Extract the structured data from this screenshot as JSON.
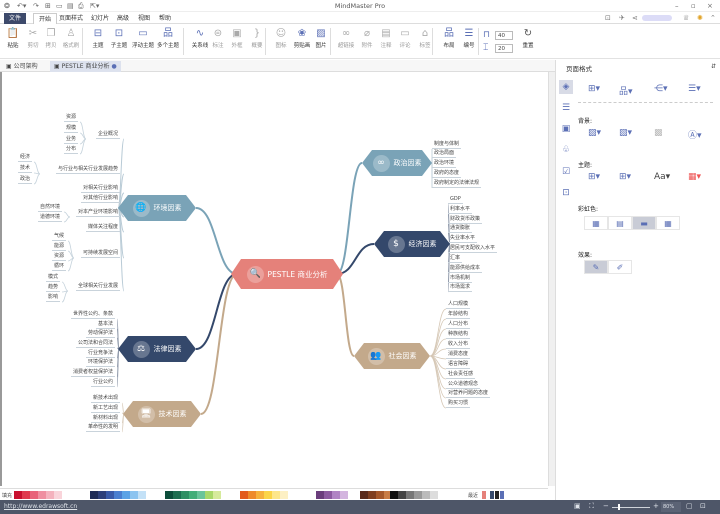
{
  "window": {
    "title": "MindMaster Pro"
  },
  "menu_tabs": [
    "文件",
    "开始",
    "页面样式",
    "幻灯片",
    "高级",
    "视图",
    "帮助"
  ],
  "ribbon": {
    "groups": [
      [
        {
          "label": "粘贴",
          "icon": "clipboard-icon"
        },
        {
          "label": "剪切",
          "icon": "scissors-icon",
          "disabled": true
        },
        {
          "label": "拷贝",
          "icon": "copy-icon",
          "disabled": true
        },
        {
          "label": "格式刷",
          "icon": "format-painter-icon",
          "disabled": true
        }
      ],
      [
        {
          "label": "主题",
          "icon": "topic-icon"
        },
        {
          "label": "子主题",
          "icon": "subtopic-icon"
        },
        {
          "label": "浮动主题",
          "icon": "floating-topic-icon"
        },
        {
          "label": "多个主题",
          "icon": "multiple-topics-icon"
        }
      ],
      [
        {
          "label": "关系线",
          "icon": "relationship-icon"
        },
        {
          "label": "标注",
          "icon": "callout-icon",
          "disabled": true
        },
        {
          "label": "外框",
          "icon": "boundary-icon",
          "disabled": true
        },
        {
          "label": "概要",
          "icon": "summary-icon",
          "disabled": true
        }
      ],
      [
        {
          "label": "图标",
          "icon": "mark-icon",
          "disabled": true
        },
        {
          "label": "剪贴画",
          "icon": "clipart-icon"
        },
        {
          "label": "图片",
          "icon": "picture-icon"
        }
      ],
      [
        {
          "label": "超链接",
          "icon": "hyperlink-icon",
          "disabled": true
        },
        {
          "label": "附件",
          "icon": "attachment-icon",
          "disabled": true
        },
        {
          "label": "注释",
          "icon": "note-icon",
          "disabled": true
        },
        {
          "label": "评论",
          "icon": "comment-icon",
          "disabled": true
        },
        {
          "label": "标签",
          "icon": "tag-icon",
          "disabled": true
        }
      ],
      [
        {
          "label": "布局",
          "icon": "layout-icon"
        },
        {
          "label": "编号",
          "icon": "numbering-icon"
        }
      ]
    ],
    "spacing_h": "40",
    "spacing_v": "20",
    "reset": "重置"
  },
  "doc_tabs": [
    {
      "label": "公司架构"
    },
    {
      "label": "PESTLE 商业分析",
      "active": true
    }
  ],
  "mindmap": {
    "central": "PESTLE  商业分析",
    "branches": [
      {
        "id": "env",
        "label": "环境因素",
        "color": "#7aa3b7",
        "icon": "globe-icon"
      },
      {
        "id": "law",
        "label": "法律因素",
        "color": "#34486b",
        "icon": "scales-icon"
      },
      {
        "id": "tech",
        "label": "技术因素",
        "color": "#c3a98b",
        "icon": "monitor-icon"
      },
      {
        "id": "pol",
        "label": "政治因素",
        "color": "#7aa3b7",
        "icon": "handcuffs-icon"
      },
      {
        "id": "eco",
        "label": "经济因素",
        "color": "#34486b",
        "icon": "dollar-search-icon"
      },
      {
        "id": "soc",
        "label": "社会因素",
        "color": "#c3a98b",
        "icon": "people-icon"
      }
    ],
    "central_color": "#e5817a",
    "env_topics": [
      "企业概况",
      "与行业与相关行业发展趋势",
      "对相关行业影响",
      "对其他行业影响",
      "对本产业环境影响",
      "媒体关注程度",
      "可持续发展空间",
      "全球相关行业发展"
    ],
    "env_sub": {
      "企业概况": [
        "资源",
        "规模",
        "业务",
        "分布"
      ],
      "与行业与相关行业发展趋势": [
        "经济",
        "技术",
        "政治"
      ],
      "对本产业环境影响": [
        "自然环境",
        "道德环境"
      ],
      "可持续发展空间": [
        "气候",
        "能源",
        "资源",
        "循环"
      ],
      "全球相关行业发展": [
        "模式",
        "趋势",
        "影响"
      ]
    },
    "law_topics": [
      "世界性公约、条款",
      "基本法",
      "劳动保护法",
      "公司法和合同法",
      "行业竞争法",
      "环境保护法",
      "消费者权益保护法",
      "行业公约"
    ],
    "tech_topics": [
      "新技术出现",
      "新工艺出现",
      "新材料出现",
      "革命性的发明"
    ],
    "pol_topics": [
      "制度与体制",
      "政治局面",
      "政治环境",
      "政府的态度",
      "政府制定的法律法规"
    ],
    "eco_topics": [
      "GDP",
      "利率水平",
      "财政货币政策",
      "通货膨胀",
      "失业率水平",
      "居民可支配收入水平",
      "汇率",
      "能源供给成本",
      "市场机制",
      "市场需求"
    ],
    "soc_topics": [
      "人口规模",
      "年龄结构",
      "人口分布",
      "种族结构",
      "收入分布",
      "消费态度",
      "语言障碍",
      "社会责任感",
      "公众道德观念",
      "对营养问题的态度",
      "购买习惯"
    ]
  },
  "panel": {
    "title": "页面格式",
    "background": "背景:",
    "theme": "主题:",
    "rainbow": "彩虹色:",
    "effect": "效果:"
  },
  "palette": {
    "fill_label": "填充",
    "recent_label": "最近"
  },
  "status": {
    "url": "http://www.edrawsoft.cn",
    "zoom": "80%"
  }
}
